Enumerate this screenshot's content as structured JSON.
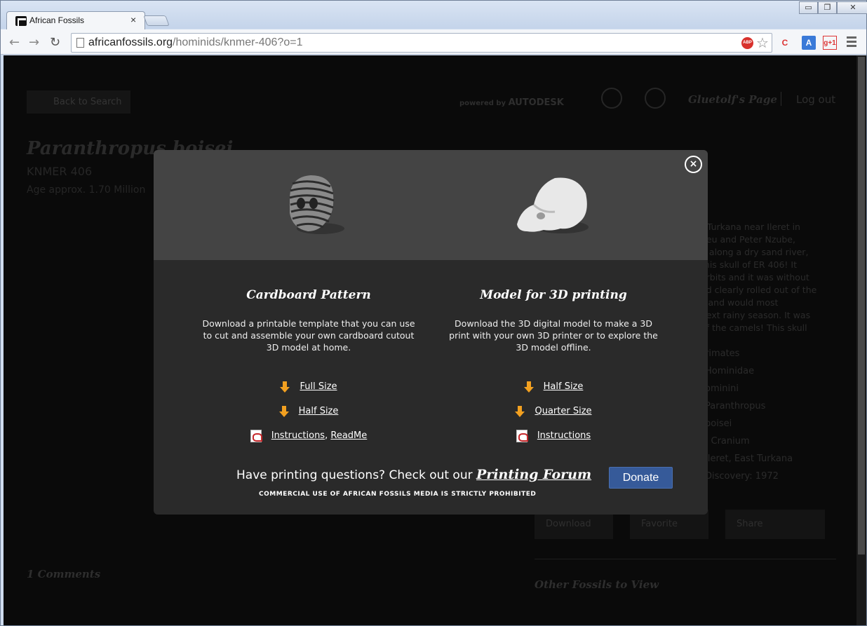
{
  "browser": {
    "tab_title": "African Fossils",
    "tab_close": "×",
    "win_minimize": "▭",
    "win_restore": "❐",
    "win_close": "✕",
    "back": "←",
    "forward": "→",
    "reload": "↻",
    "url_domain": "africanfossils.org",
    "url_path": "/hominids/knmer-406?o=1",
    "adblock_label": "ABP",
    "star": "☆",
    "ext_c": "C",
    "ext_translate": "A",
    "ext_gplus": "g+1"
  },
  "background_page": {
    "back_label": "Back to Search",
    "powered_by": "powered by",
    "autodesk": "AUTODESK",
    "user_page": "Gluetolf's Page",
    "logout": "Log out",
    "species": "Paranthropus boisei",
    "specimen": "KNMER 406",
    "age": "Age approx. 1.70 Million",
    "description": "t Turkana near Ileret in\nheu and Peter Nzube,\ng along a dry sand river,\nthis skull of ER 406! It\norbits and it was without\ned clearly rolled out of the\ns and would most\nnext rainy season. It was\nof the camels! This skull",
    "taxonomy": [
      "rimates",
      "Hominidae",
      "ominini",
      "Paranthropus",
      "boisei",
      ": Cranium",
      "Ileret, East Turkana",
      "Discovery: 1972"
    ],
    "download": "Download",
    "favorite": "Favorite",
    "share": "Share",
    "other_fossils": "Other Fossils to View",
    "comments": "1 Comments"
  },
  "modal": {
    "close_icon": "×",
    "cardboard": {
      "heading": "Cardboard Pattern",
      "description": "Download a printable template that you can use to cut and assemble your own cardboard cutout 3D model at home.",
      "links": [
        "Full Size",
        "Half Size"
      ],
      "instructions": "Instructions",
      "comma": ",",
      "readme": "ReadMe"
    },
    "printing": {
      "heading": "Model for 3D printing",
      "description": "Download the 3D digital model to make a 3D print with your own 3D printer or to explore the 3D model offline.",
      "links": [
        "Half Size",
        "Quarter Size"
      ],
      "instructions": "Instructions"
    },
    "forum_prefix": "Have printing questions? Check out our",
    "forum_link": "Printing Forum",
    "commercial_notice": "Commercial use of African Fossils media is strictly prohibited",
    "donate": "Donate"
  }
}
